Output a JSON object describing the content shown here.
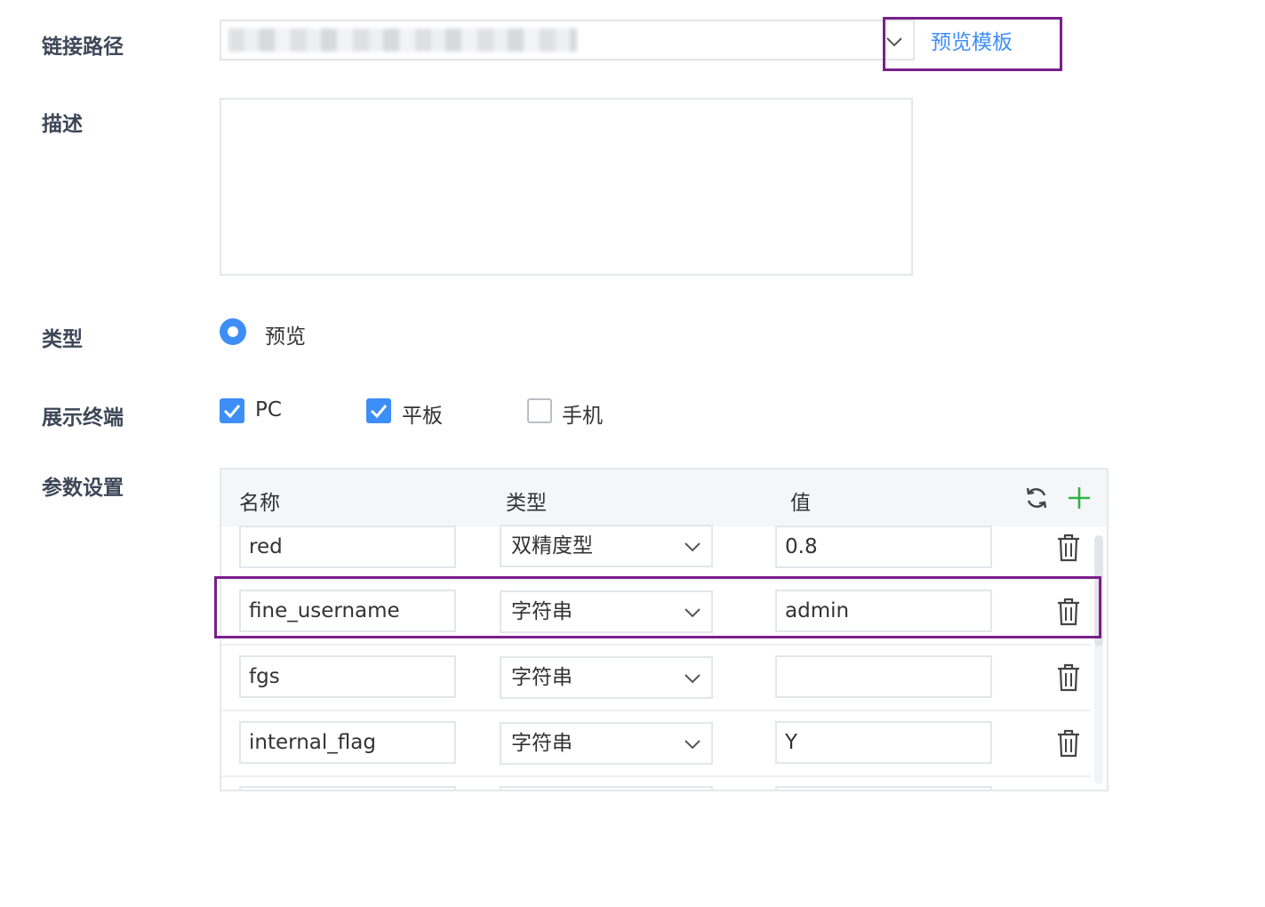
{
  "form": {
    "link_path": {
      "label": "链接路径",
      "value": "",
      "preview_button": "预览模板"
    },
    "description": {
      "label": "描述",
      "value": ""
    },
    "type": {
      "label": "类型",
      "option": "预览"
    },
    "terminals": {
      "label": "展示终端",
      "options": [
        {
          "label": "PC",
          "checked": true
        },
        {
          "label": "平板",
          "checked": true
        },
        {
          "label": "手机",
          "checked": false
        }
      ]
    },
    "params": {
      "label": "参数设置",
      "columns": [
        "名称",
        "类型",
        "值"
      ],
      "rows": [
        {
          "name": "red",
          "type": "双精度型",
          "value": "0.8"
        },
        {
          "name": "fine_username",
          "type": "字符串",
          "value": "admin"
        },
        {
          "name": "fgs",
          "type": "字符串",
          "value": ""
        },
        {
          "name": "internal_flag",
          "type": "字符串",
          "value": "Y"
        }
      ]
    }
  },
  "icons": {
    "refresh": "refresh-icon",
    "add": "plus-icon",
    "delete": "trash-icon",
    "dropdown": "chevron-down-icon"
  },
  "colors": {
    "accent": "#3e8ef7",
    "add_green": "#2fb344",
    "highlight": "#7a1f8c"
  }
}
